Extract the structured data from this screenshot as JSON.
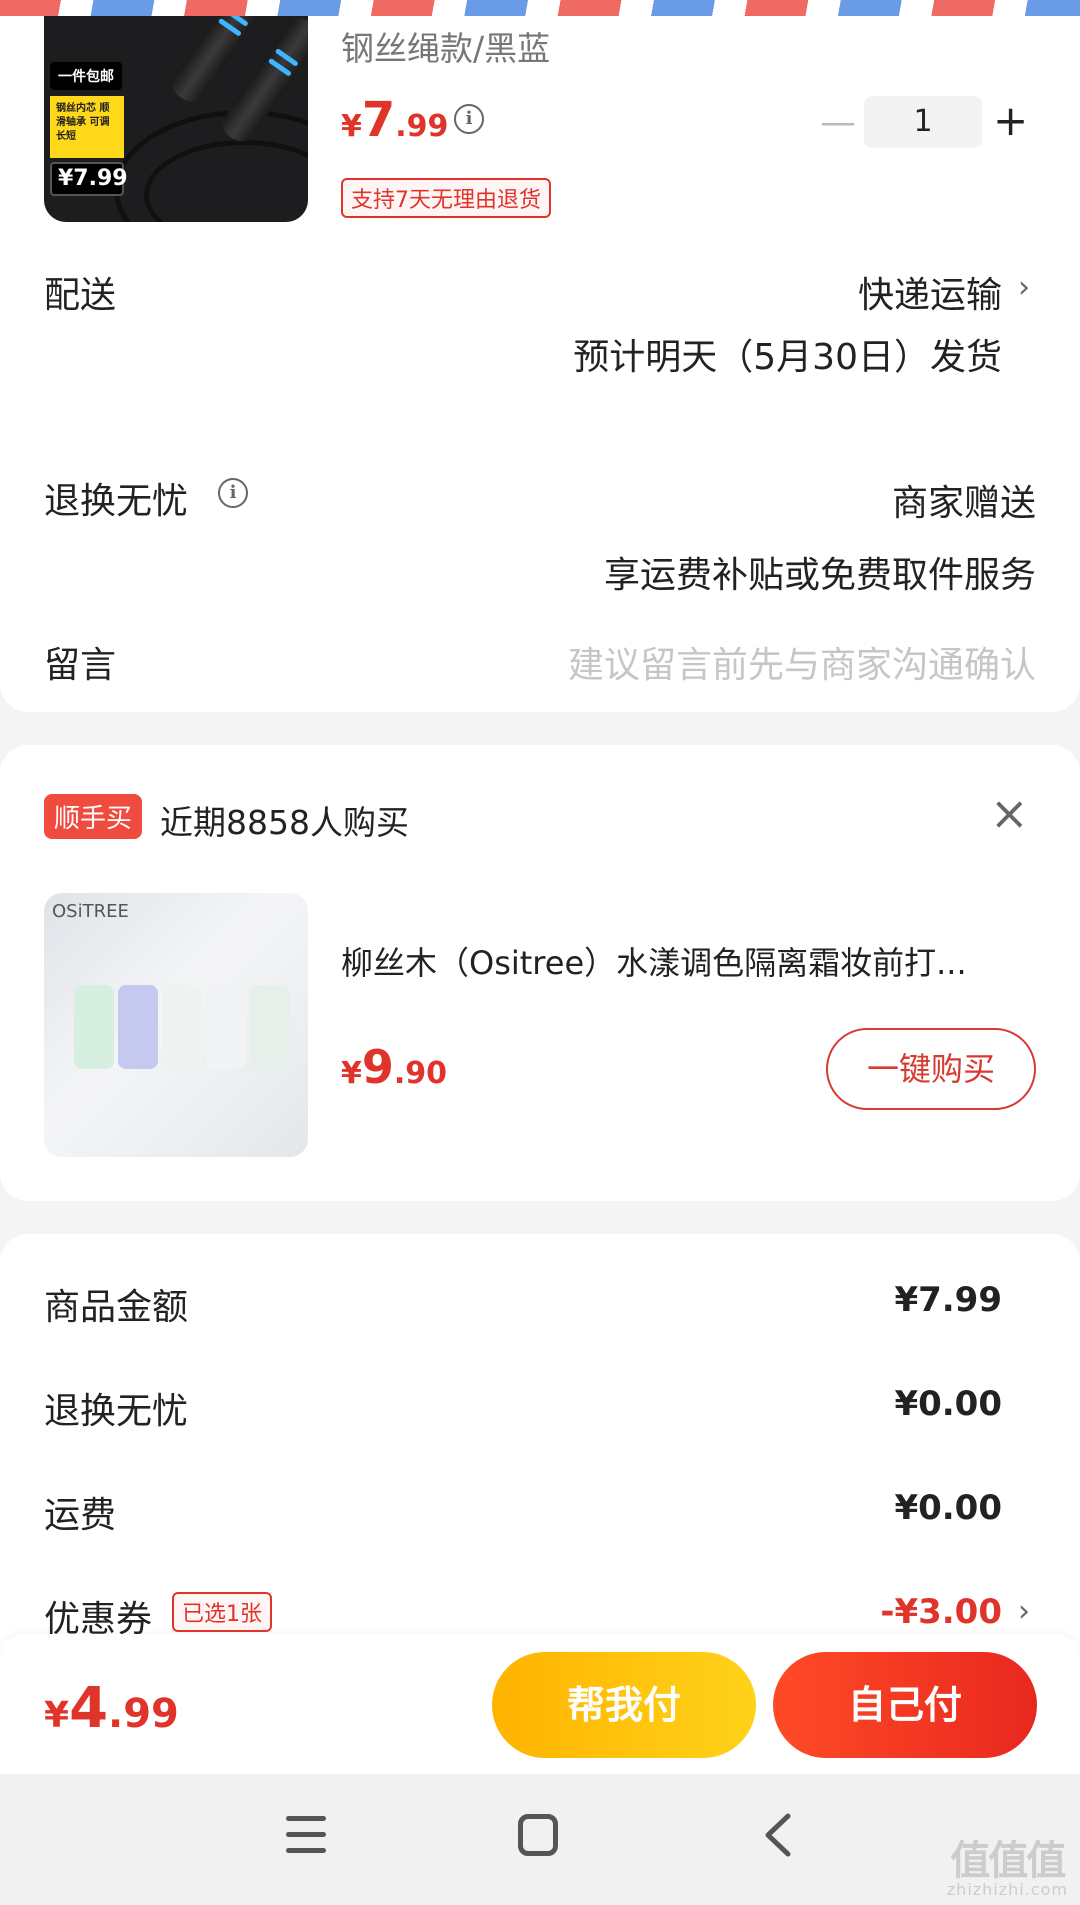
{
  "order_item": {
    "variant": "钢丝绳款/黑蓝",
    "price_symbol": "¥",
    "price_int": "7",
    "price_dec": ".99",
    "quantity": "1",
    "minus_label": "—",
    "plus_label": "+",
    "return_tag": "支持7天无理由退货",
    "image_texts": {
      "badge": "一件包邮",
      "features": "钢丝内芯 顺滑轴承 可调长短",
      "price": "¥7.99"
    }
  },
  "delivery": {
    "label": "配送",
    "method": "快递运输",
    "eta": "预计明天（5月30日）发货"
  },
  "return_service": {
    "label": "退换无忧",
    "value": "商家赠送",
    "desc": "享运费补贴或免费取件服务"
  },
  "message": {
    "label": "留言",
    "placeholder": "建议留言前先与商家沟通确认"
  },
  "upsell": {
    "badge": "顺手买",
    "recent_text": "近期8858人购买",
    "close": "×",
    "brand_on_image": "OSiTREE",
    "title": "柳丝木（Ositree）水漾调色隔离霜妆前打...",
    "price_symbol": "¥",
    "price_int": "9",
    "price_dec": ".90",
    "buy_label": "一键购买"
  },
  "summary": {
    "goods_label": "商品金额",
    "goods_value": "¥7.99",
    "return_label": "退换无忧",
    "return_value": "¥0.00",
    "shipping_label": "运费",
    "shipping_value": "¥0.00",
    "coupon_label": "优惠券",
    "coupon_tag": "已选1张",
    "coupon_value": "-¥3.00"
  },
  "checkout": {
    "price_symbol": "¥",
    "price_int": "4",
    "price_dec": ".99",
    "help_pay_label": "帮我付",
    "self_pay_label": "自己付"
  },
  "watermark": {
    "main": "值值值",
    "sub": "zhizhizhi.com"
  },
  "colors": {
    "accent_red": "#e0342b",
    "help_btn": "#ffc20e",
    "self_btn": "#f0391f"
  }
}
